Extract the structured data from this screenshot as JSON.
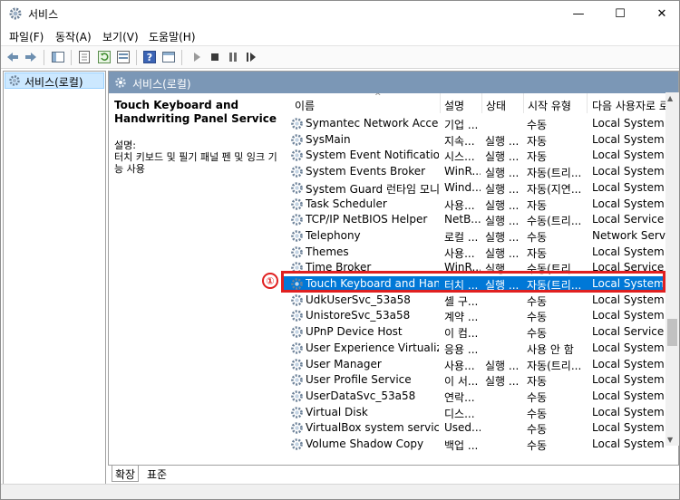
{
  "window": {
    "title": "서비스",
    "minimize": "—",
    "maximize": "☐",
    "close": "✕"
  },
  "menu": [
    "파일(F)",
    "동작(A)",
    "보기(V)",
    "도움말(H)"
  ],
  "toolbar": {
    "icons": [
      "back-arrow",
      "forward-arrow",
      "console-tree",
      "properties",
      "refresh",
      "export-list",
      "help",
      "show-hide",
      "play",
      "stop",
      "pause",
      "restart"
    ]
  },
  "tree": {
    "item": "서비스(로컬)"
  },
  "pane": {
    "header": "서비스(로컬)",
    "service_title": "Touch Keyboard and Handwriting Panel Service",
    "desc_label": "설명:",
    "desc_text": "터치 키보드 및 필기 패널 펜 및 잉크 기능 사용"
  },
  "columns": {
    "name": "이름",
    "desc": "설명",
    "state": "상태",
    "start": "시작 유형",
    "logon": "다음 사용자로 로"
  },
  "rows": [
    [
      "Symantec Network Access ...",
      "기업 ...",
      "",
      "수동",
      "Local System"
    ],
    [
      "SysMain",
      "지속...",
      "실행 ...",
      "자동",
      "Local System"
    ],
    [
      "System Event Notification ...",
      "시스...",
      "실행 ...",
      "자동",
      "Local System"
    ],
    [
      "System Events Broker",
      "WinR...",
      "실행 ...",
      "자동(트리...",
      "Local System"
    ],
    [
      "System Guard 런타임 모니...",
      "Wind...",
      "실행 ...",
      "자동(지연...",
      "Local System"
    ],
    [
      "Task Scheduler",
      "사용...",
      "실행 ...",
      "자동",
      "Local System"
    ],
    [
      "TCP/IP NetBIOS Helper",
      "NetB...",
      "실행 ...",
      "수동(트리...",
      "Local Service"
    ],
    [
      "Telephony",
      "로컬 ...",
      "실행 ...",
      "수동",
      "Network Service"
    ],
    [
      "Themes",
      "사용...",
      "실행 ...",
      "자동",
      "Local System"
    ],
    [
      "Time Broker",
      "WinR...",
      "실행 ...",
      "수동(트리...",
      "Local Service"
    ],
    [
      "Touch Keyboard and Hand...",
      "터치 ...",
      "실행 ...",
      "자동(트리...",
      "Local System"
    ],
    [
      "UdkUserSvc_53a58",
      "셸 구...",
      "",
      "수동",
      "Local System"
    ],
    [
      "UnistoreSvc_53a58",
      "계약 ...",
      "",
      "수동",
      "Local System"
    ],
    [
      "UPnP Device Host",
      "이 컴...",
      "",
      "수동",
      "Local Service"
    ],
    [
      "User Experience Virtualizati...",
      "응용 ...",
      "",
      "사용 안 함",
      "Local System"
    ],
    [
      "User Manager",
      "사용...",
      "실행 ...",
      "자동(트리...",
      "Local System"
    ],
    [
      "User Profile Service",
      "이 서...",
      "실행 ...",
      "자동",
      "Local System"
    ],
    [
      "UserDataSvc_53a58",
      "연락...",
      "",
      "수동",
      "Local System"
    ],
    [
      "Virtual Disk",
      "디스...",
      "",
      "수동",
      "Local System"
    ],
    [
      "VirtualBox system service",
      "Used...",
      "",
      "수동",
      "Local System"
    ],
    [
      "Volume Shadow Copy",
      "백업 ...",
      "",
      "수동",
      "Local System"
    ]
  ],
  "selected_row": 10,
  "tabs": {
    "extended": "확장",
    "standard": "표준"
  },
  "callout": {
    "number": "①",
    "color": "#e02020"
  },
  "colors": {
    "header_bg": "#7b97b6",
    "selection": "#0078d7",
    "tree_selection": "#cce8ff"
  }
}
